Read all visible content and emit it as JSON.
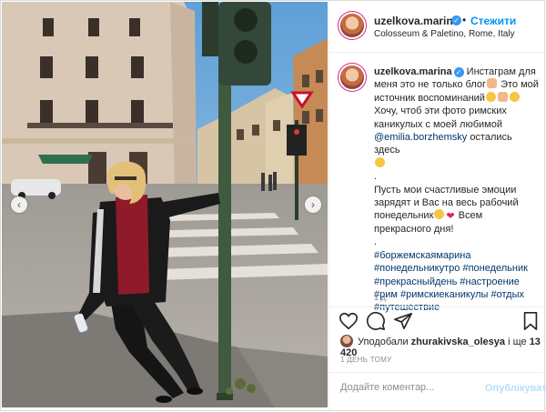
{
  "post": {
    "username": "uzelkova.marina",
    "follow_label": "Стежити",
    "location": "Colosseum & Paletino, Rome, Italy",
    "caption": {
      "username": "uzelkova.marina",
      "line1": "Инстаграм для меня это не только блог",
      "line2": "Это мой источник воспоминаний",
      "line3": "Хочу, чтоб эти фото римских каникулых с моей любимой",
      "mention": "@emilia.borzhemsky",
      "line4": "остались здесь",
      "dot": ".",
      "line5": "Пусть мои счастливые эмоции зарядят и Вас на весь рабочий понедельник",
      "line6": "Всем прекрасного дня!",
      "dot2": ".",
      "hashtags": "#боржемскаямарина #понедельникутро #понедельник #прекрасныйдень #настроение #рим #римскиеканикулы #отдых #путешествие"
    },
    "time_ago": "1 д.",
    "likes": {
      "prefix": "Уподобали",
      "user": "zhurakivska_olesya",
      "middle": "і ще",
      "count": "13 420"
    },
    "date": "1 ДЕНЬ ТОМУ",
    "comment_placeholder": "Додайте коментар...",
    "publish_label": "Опублікувати"
  },
  "icons": {
    "like": "heart-outline-icon",
    "comment": "comment-bubble-icon",
    "share": "paper-plane-icon",
    "save": "bookmark-icon",
    "verified": "verified-badge-icon",
    "prev": "chevron-left-icon",
    "next": "chevron-right-icon"
  },
  "colors": {
    "link": "#0095f6",
    "hashtag": "#00376b",
    "muted": "#8e8e8e",
    "publish_disabled": "#b2dffc"
  }
}
